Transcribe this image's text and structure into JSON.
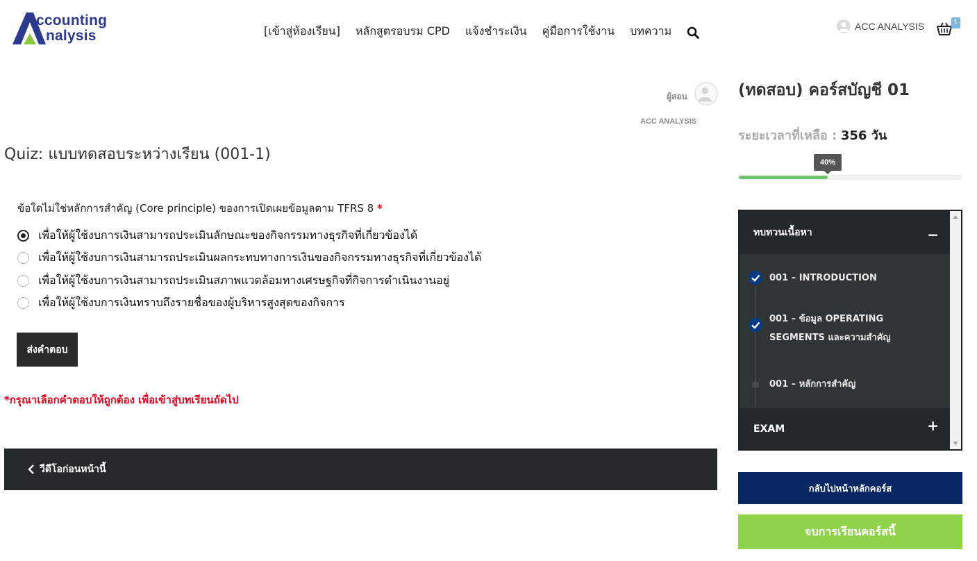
{
  "brand": {
    "line1": "ccounting",
    "line2": "nalysis"
  },
  "nav": {
    "items": [
      "[เข้าสู่ห้องเรียน]",
      "หลักสูตรอบรม CPD",
      "แจ้งชำระเงิน",
      "คู่มือการใช้งาน",
      "บทความ"
    ]
  },
  "user": {
    "name": "ACC ANALYSIS"
  },
  "cart": {
    "count": "1"
  },
  "instructor": {
    "label": "ผู้สอน",
    "name": "ACC ANALYSIS"
  },
  "quiz": {
    "title": "Quiz: แบบทดสอบระหว่างเรียน (001-1)",
    "question": "ข้อใดไม่ใช่หลักการสำคัญ (Core principle) ของการเปิดเผยข้อมูลตาม TFRS 8",
    "required_mark": "*",
    "options": [
      "เพื่อให้ผู้ใช้งบการเงินสามารถประเมินลักษณะของกิจกรรมทางธุรกิจที่เกี่ยวข้องได้",
      "เพื่อให้ผู้ใช้งบการเงินสามารถประเมินผลกระทบทางการเงินของกิจกรรมทางธุรกิจที่เกี่ยวข้องได้",
      "เพื่อให้ผู้ใช้งบการเงินสามารถประเมินสภาพแวดล้อมทางเศรษฐกิจที่กิจการดำเนินงานอยู่",
      "เพื่อให้ผู้ใช้งบการเงินทราบถึงรายชื่อของผู้บริหารสูงสุดของกิจการ"
    ],
    "selected_index": 0,
    "submit_label": "ส่งคำตอบ",
    "warning": "*กรุณาเลือกคำตอบให้ถูกต้อง เพื่อเข้าสู่บทเรียนถัดไป",
    "prev_label": "วีดีโอก่อนหน้านี้"
  },
  "sidebar": {
    "course_title": "(ทดสอบ) คอร์สบัญชี 01",
    "time_left_label": "ระยะเวลาที่เหลือ :",
    "time_left_value": "356 วัน",
    "progress_label": "40%",
    "progress_fraction": 0.4,
    "sections": [
      {
        "title": "ทบทวนเนื้อหา",
        "toggle": "−"
      },
      {
        "title": "EXAM",
        "toggle": "+"
      }
    ],
    "lessons": [
      {
        "title": "001 – INTRODUCTION",
        "completed": true
      },
      {
        "title": "001 – ข้อมูล OPERATING SEGMENTS และความสำคัญ",
        "completed": true
      },
      {
        "title": "001 – หลักการสำคัญ",
        "completed": false
      }
    ],
    "back_label": "กลับไปหน้าหลักคอร์ส",
    "finish_label": "จบการเรียนคอร์สนี้"
  },
  "colors": {
    "brand_blue": "#2b3990",
    "brand_green": "#8dc63f",
    "progress_green": "#72c46c",
    "warning_red": "#e8001c",
    "back_button": "#072863",
    "finish_button": "#8fd34b"
  }
}
